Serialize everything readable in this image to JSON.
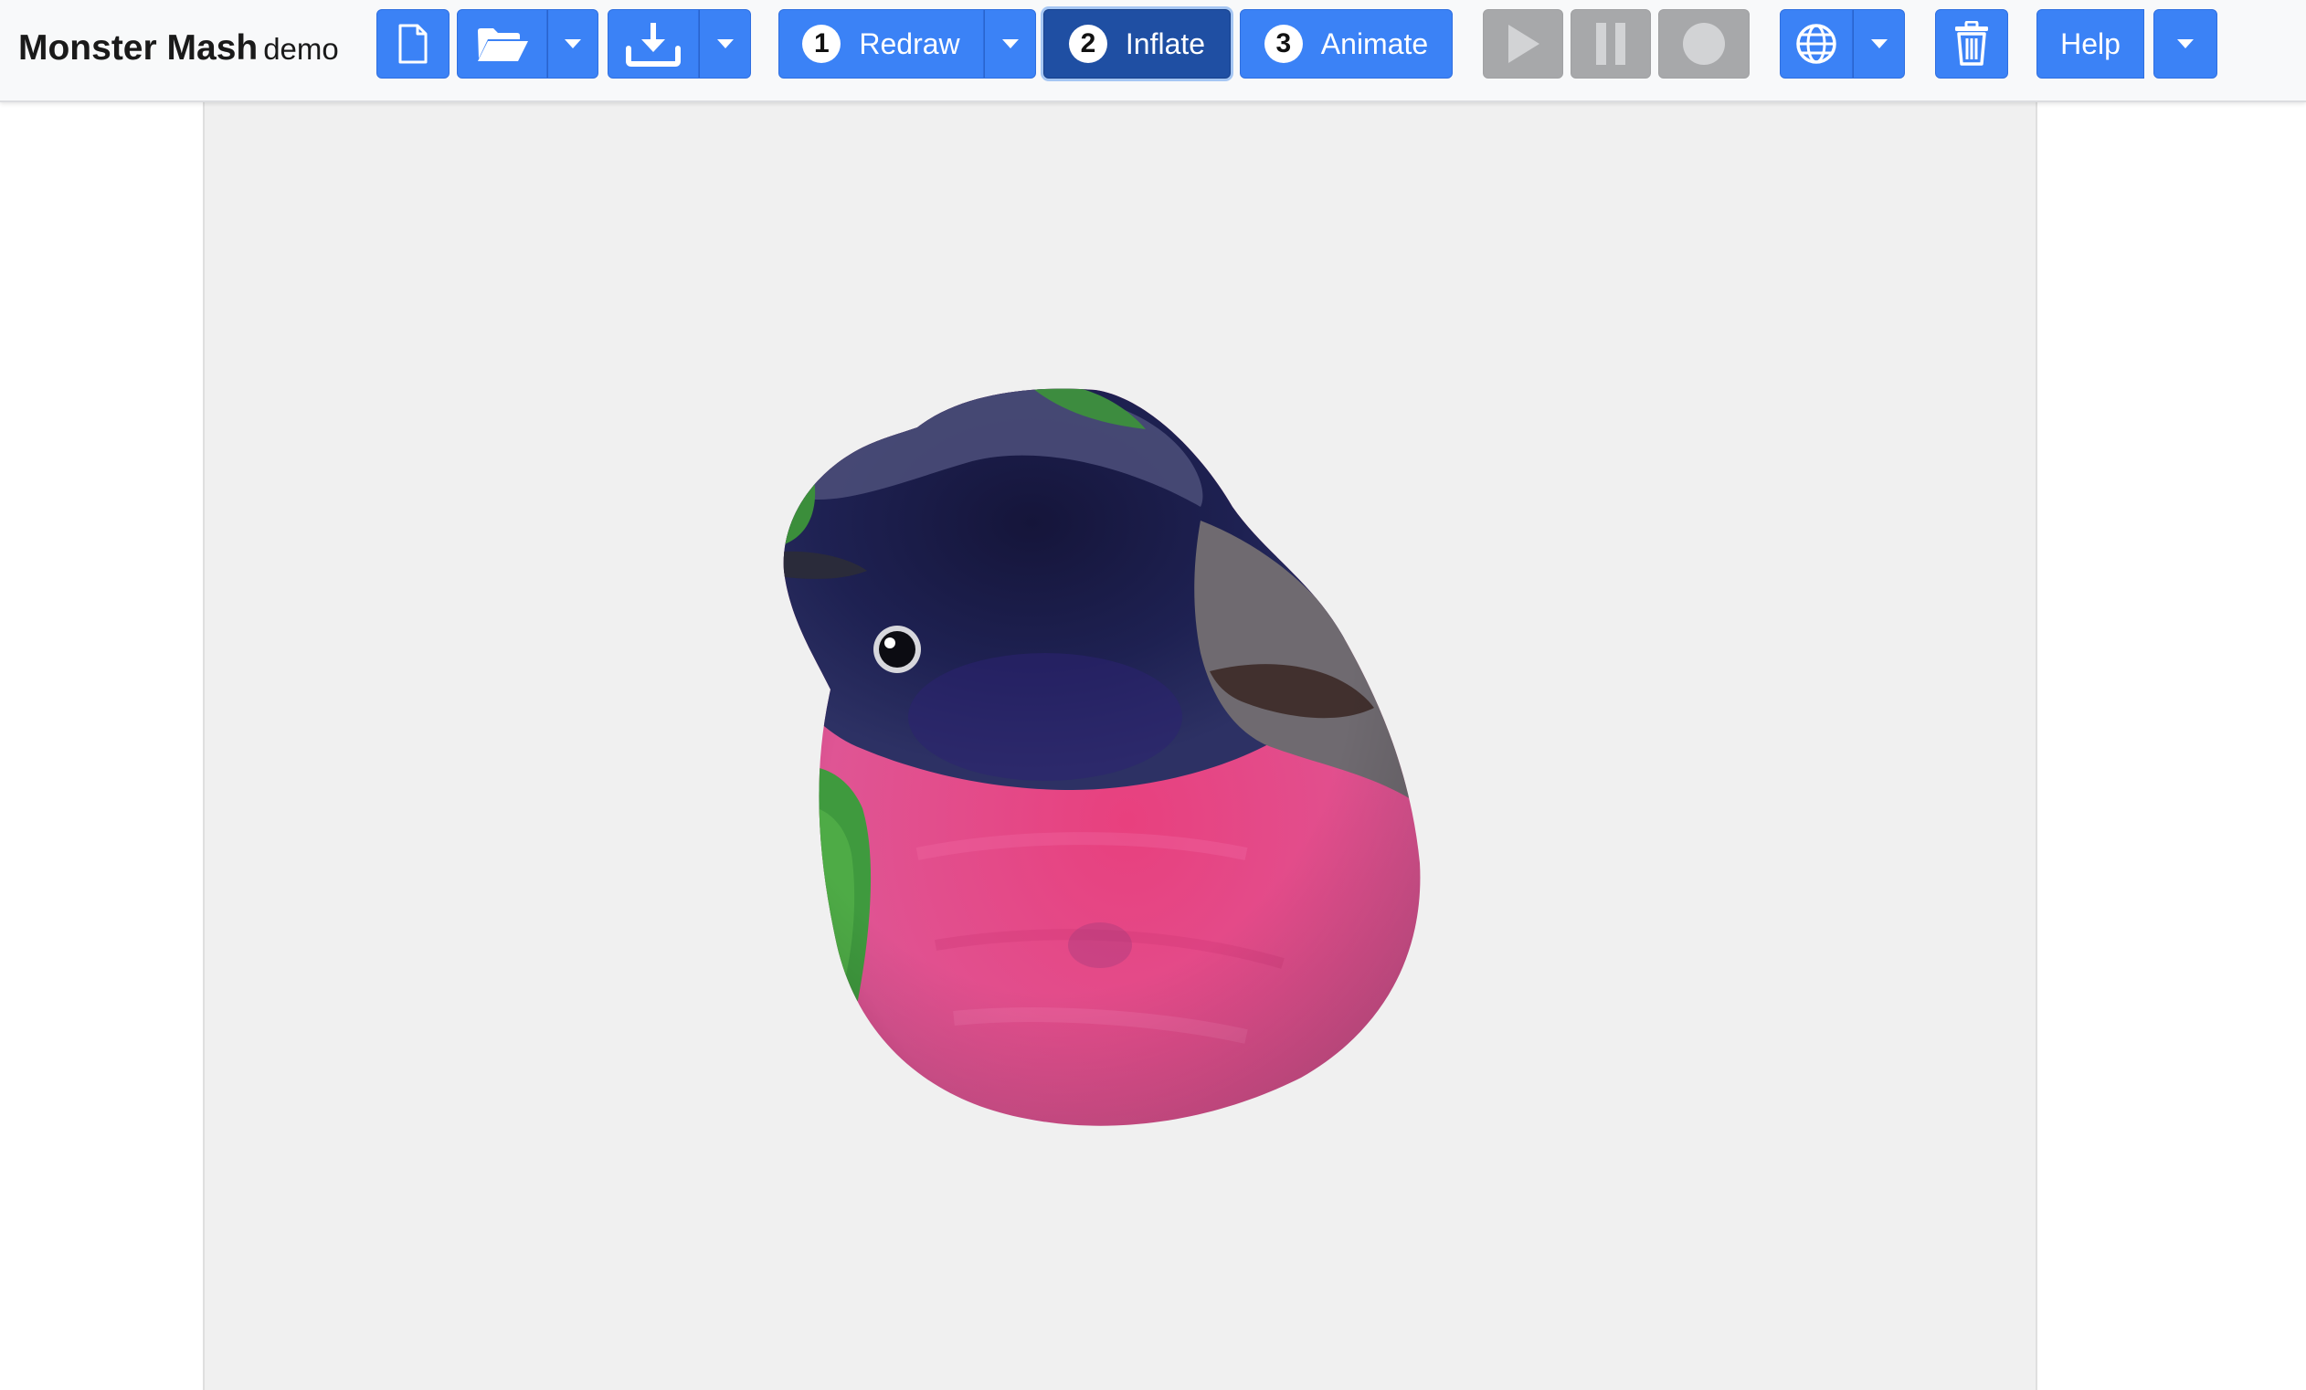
{
  "app": {
    "title": "Monster Mash",
    "subtitle": "demo"
  },
  "toolbar": {
    "steps": [
      {
        "number": "1",
        "label": "Redraw"
      },
      {
        "number": "2",
        "label": "Inflate"
      },
      {
        "number": "3",
        "label": "Animate"
      }
    ],
    "help_label": "Help",
    "active_step": "Inflate",
    "playback_state": "disabled"
  },
  "icons": {
    "new": "file-icon",
    "open": "folder-open-icon",
    "save": "download-icon",
    "play": "play-icon",
    "pause": "pause-icon",
    "record": "record-icon",
    "web": "globe-icon",
    "delete": "trash-icon",
    "dropdown": "caret-down-icon"
  },
  "colors": {
    "primary": "#3b82f6",
    "active": "#1f4fa3",
    "disabled": "#a7a8aa",
    "canvas": "#f0f0f0"
  }
}
